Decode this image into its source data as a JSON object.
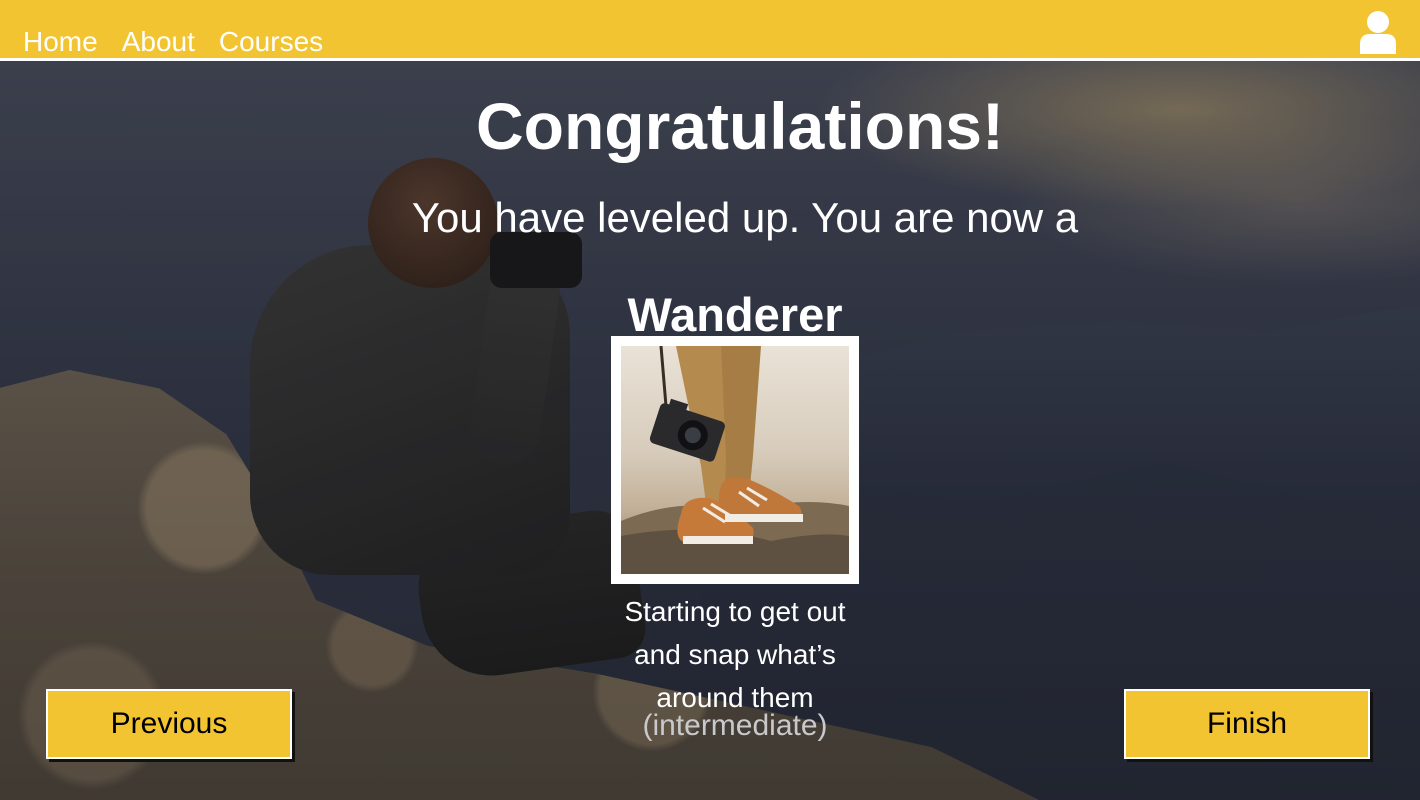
{
  "nav": {
    "links": [
      "Home",
      "About",
      "Courses"
    ],
    "user_icon": "user-icon"
  },
  "main": {
    "title": "Congratulations!",
    "subtitle": "You have leveled up. You are now a",
    "level_name": "Wanderer",
    "description_lines": [
      "Starting to get out",
      "and snap what’s",
      "around them"
    ],
    "level_tag": "(intermediate)"
  },
  "buttons": {
    "previous": "Previous",
    "finish": "Finish"
  },
  "colors": {
    "accent": "#f3c431",
    "text": "#ffffff",
    "muted_text": "#c9c9cc"
  }
}
